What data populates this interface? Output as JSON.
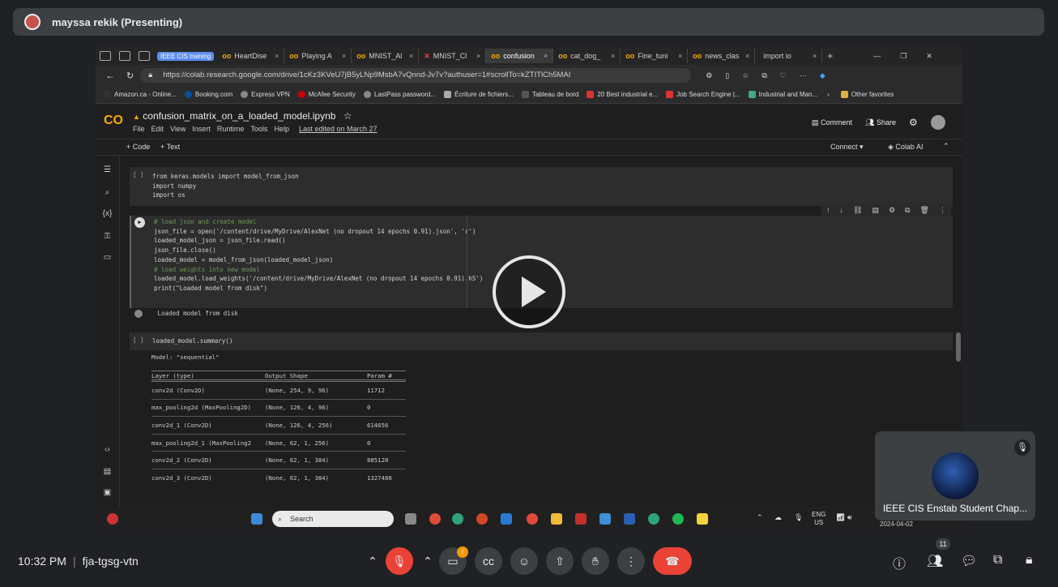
{
  "presenter": {
    "name": "mayssa rekik (Presenting)"
  },
  "browser": {
    "group_label": "IEEE CIS training",
    "tabs": [
      "HeartDise",
      "Playing A",
      "MNIST_Al",
      "MNIST_Cl",
      "confusion",
      "cat_dog_",
      "Fine_tuni",
      "news_clas",
      "import io"
    ],
    "url": "https://colab.research.google.com/drive/1cKz3KVeU7jB5yLNp9MsbA7vQnnd-Jv7v?authuser=1#scrollTo=kZTITlCh5MAI",
    "bookmarks": [
      "Amazon.ca - Online...",
      "Booking.com",
      "Express VPN",
      "McAfee Security",
      "LastPass password...",
      "Écriture de fichiers...",
      "Tableau de bord",
      "20 Best industrial e...",
      "Job Search Engine |...",
      "Industrial and Man..."
    ],
    "other_favorites": "Other favorites"
  },
  "colab": {
    "logo": "CO",
    "title": "confusion_matrix_on_a_loaded_model.ipynb",
    "menu": [
      "File",
      "Edit",
      "View",
      "Insert",
      "Runtime",
      "Tools",
      "Help"
    ],
    "last_edited": "Last edited on March 27",
    "comment": "Comment",
    "share": "Share",
    "add_code": "+ Code",
    "add_text": "+ Text",
    "connect": "Connect",
    "colab_ai": "Colab AI"
  },
  "cells": {
    "cell1_bracket": "[ ]",
    "cell1": [
      "from keras.models import model_from_json",
      "import numpy",
      "import os"
    ],
    "cell2": [
      "# load json and create model",
      "json_file = open('/content/drive/MyDrive/AlexNet (no dropout 14 epochs 0.91).json', 'r')",
      "loaded_model_json = json_file.read()",
      "json_file.close()",
      "loaded_model = model_from_json(loaded_model_json)",
      "# load weights into new model",
      "loaded_model.load_weights('/content/drive/MyDrive/AlexNet (no dropout 14 epochs 0.91).h5')",
      "print(\"Loaded model from disk\")"
    ],
    "cell2_output": "Loaded model from disk",
    "cell3_bracket": "[ ]",
    "cell3": "loaded_model.summary()",
    "model_line": "Model: \"sequential\"",
    "summary_headers": [
      "Layer (type)",
      "Output Shape",
      "Param #"
    ],
    "summary_rows": [
      [
        "conv2d (Conv2D)",
        "(None, 254, 9, 96)",
        "11712"
      ],
      [
        "max_pooling2d (MaxPooling2D)",
        "(None, 126, 4, 96)",
        "0"
      ],
      [
        "conv2d_1 (Conv2D)",
        "(None, 126, 4, 256)",
        "614656"
      ],
      [
        "max_pooling2d_1 (MaxPooling2",
        "(None, 62, 1, 256)",
        "0"
      ],
      [
        "conv2d_2 (Conv2D)",
        "(None, 62, 1, 384)",
        "885120"
      ],
      [
        "conv2d_3 (Conv2D)",
        "(None, 62, 1, 384)",
        "1327488"
      ]
    ]
  },
  "taskbar": {
    "search": "Search",
    "lang": "ENG",
    "region": "US",
    "date": "2024-04-02"
  },
  "participant_tile": {
    "name": "IEEE CIS Enstab Student Chap..."
  },
  "meeting": {
    "time": "10:32 PM",
    "code": "fja-tgsg-vtn",
    "participants_count": "11"
  },
  "colors": {
    "end_call": "#ea4335",
    "mic_off": "#ea4335",
    "colab_orange": "#f9ab00"
  }
}
